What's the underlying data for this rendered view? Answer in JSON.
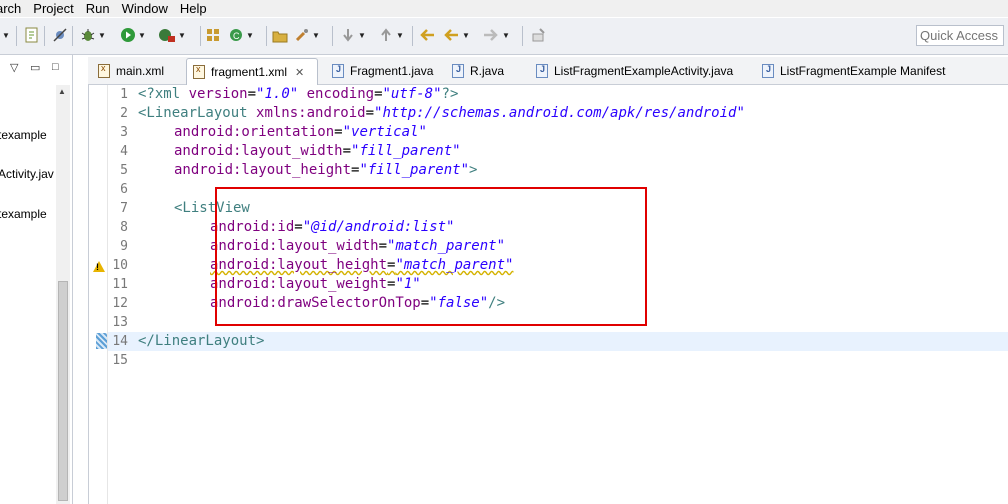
{
  "menu": {
    "items": [
      "arch",
      "Project",
      "Run",
      "Window",
      "Help"
    ]
  },
  "toolbar": {
    "quick_access_placeholder": "Quick Access"
  },
  "explorer": {
    "items": [
      "texample",
      "Activity.jav",
      "texample"
    ]
  },
  "tabs": [
    {
      "label": "main.xml",
      "icon": "xml-file-icon"
    },
    {
      "label": "fragment1.xml",
      "icon": "xml-file-icon",
      "active": true
    },
    {
      "label": "Fragment1.java",
      "icon": "java-file-icon"
    },
    {
      "label": "R.java",
      "icon": "java-file-icon"
    },
    {
      "label": "ListFragmentExampleActivity.java",
      "icon": "java-file-icon"
    },
    {
      "label": "ListFragmentExample Manifest",
      "icon": "manifest-file-icon"
    }
  ],
  "editor": {
    "line_numbers": [
      "1",
      "2",
      "3",
      "4",
      "5",
      "6",
      "7",
      "8",
      "9",
      "10",
      "11",
      "12",
      "13",
      "14",
      "15"
    ],
    "code": {
      "l1_open": "<?xml ",
      "l1_a1": "version",
      "l1_eq1": "=",
      "l1_v1": "\"1.0\"",
      "l1_sp": " ",
      "l1_a2": "encoding",
      "l1_eq2": "=",
      "l1_v2": "\"utf-8\"",
      "l1_close": "?>",
      "l2_tag": "<LinearLayout",
      "l2_sp": " ",
      "l2_attr": "xmlns:android",
      "l2_eq": "=",
      "l2_val": "\"http://schemas.android.com/apk/res/android\"",
      "l3_attr": "android:orientation",
      "l3_eq": "=",
      "l3_val": "\"vertical\"",
      "l4_attr": "android:layout_width",
      "l4_eq": "=",
      "l4_val": "\"fill_parent\"",
      "l5_attr": "android:layout_height",
      "l5_eq": "=",
      "l5_val": "\"fill_parent\"",
      "l5_close": ">",
      "l7_tag": "<ListView",
      "l8_attr": "android:id",
      "l8_eq": "=",
      "l8_val": "\"@id/android:list\"",
      "l9_attr": "android:layout_width",
      "l9_eq": "=",
      "l9_val": "\"match_parent\"",
      "l10_attr": "android:layout_height",
      "l10_eq": "=",
      "l10_val": "\"match_parent\"",
      "l11_attr": "android:layout_weight",
      "l11_eq": "=",
      "l11_val": "\"1\"",
      "l12_attr": "android:drawSelectorOnTop",
      "l12_eq": "=",
      "l12_val": "\"false\"",
      "l12_close": "/>",
      "l14_tag": "</LinearLayout>"
    }
  },
  "colors": {
    "highlight_box": "#e00000",
    "tag": "#3f7f7f",
    "attribute": "#7f007f",
    "string": "#2a00ff",
    "current_line": "#e8f2fe"
  }
}
